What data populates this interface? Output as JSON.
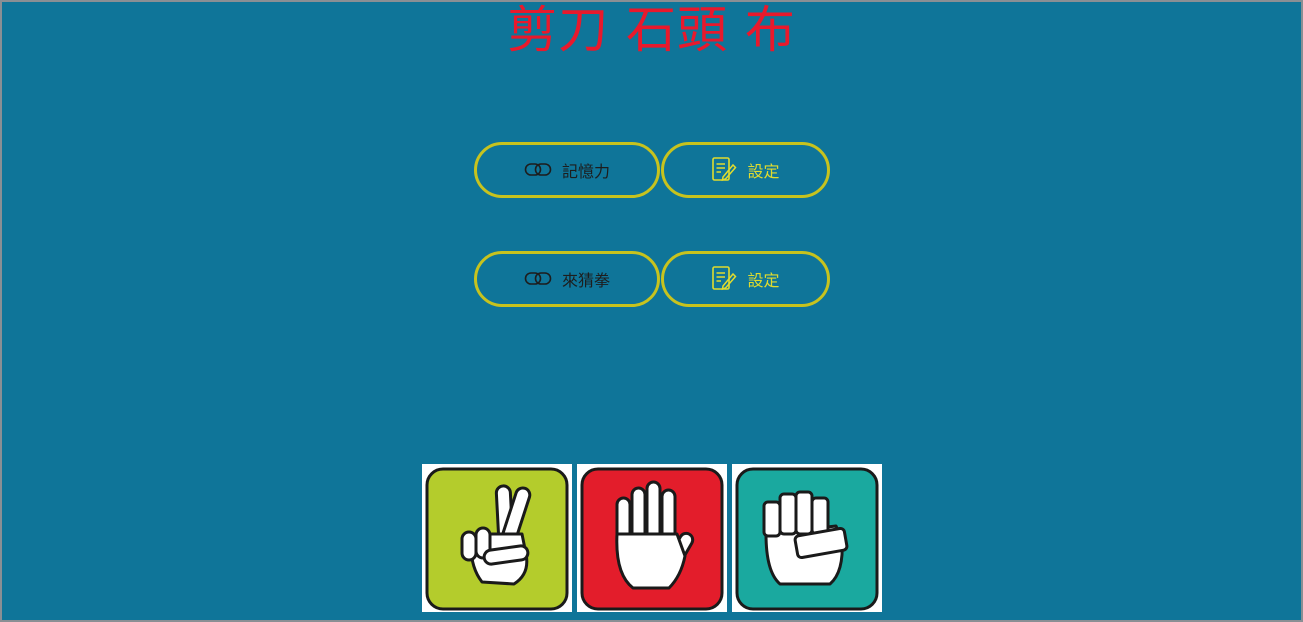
{
  "title": "剪刀 石頭 布",
  "rows": [
    {
      "main_label": "記憶力",
      "main_icon": "link-icon",
      "settings_label": "設定",
      "settings_icon": "edit-note-icon"
    },
    {
      "main_label": "來猜拳",
      "main_icon": "link-icon",
      "settings_label": "設定",
      "settings_icon": "edit-note-icon"
    }
  ],
  "hands": [
    {
      "name": "scissors",
      "icon": "scissors-hand-icon",
      "color": "#b4cc2c"
    },
    {
      "name": "paper",
      "icon": "paper-hand-icon",
      "color": "#e31d2b"
    },
    {
      "name": "rock",
      "icon": "rock-fist-icon",
      "color": "#1aa99f"
    }
  ],
  "colors": {
    "background": "#0f7599",
    "title": "#e8192c",
    "button_border": "#c7c31e",
    "settings_text": "#e0dc2e"
  }
}
